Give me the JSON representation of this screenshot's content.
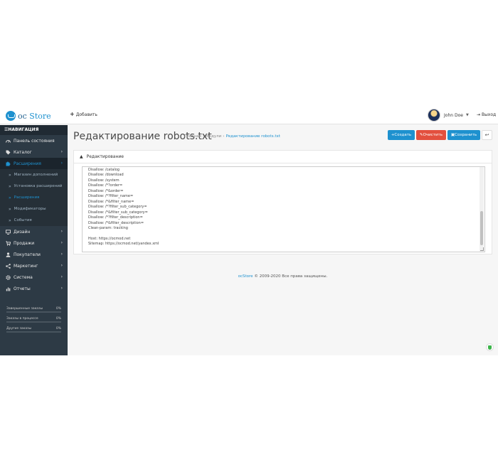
{
  "header": {
    "logo_prefix": "oc",
    "logo_name": "Store",
    "add_label": "Добавить",
    "user_name": "John Doe",
    "logout_label": "Выход"
  },
  "sidebar": {
    "nav_title": "НАВИГАЦИЯ",
    "items": [
      {
        "label": "Панель состояния",
        "icon": "dashboard-icon"
      },
      {
        "label": "Каталог",
        "icon": "tag-icon"
      },
      {
        "label": "Расширения",
        "icon": "puzzle-icon"
      },
      {
        "label": "Дизайн",
        "icon": "monitor-icon"
      },
      {
        "label": "Продажи",
        "icon": "cart-icon"
      },
      {
        "label": "Покупатели",
        "icon": "user-icon"
      },
      {
        "label": "Маркетинг",
        "icon": "share-icon"
      },
      {
        "label": "Система",
        "icon": "gear-icon"
      },
      {
        "label": "Отчеты",
        "icon": "bar-chart-icon"
      }
    ],
    "sub_items": [
      {
        "label": "Магазин дополнений"
      },
      {
        "label": "Установка расширений"
      },
      {
        "label": "Расширения"
      },
      {
        "label": "Модификаторы"
      },
      {
        "label": "События"
      }
    ],
    "stats": [
      {
        "label": "Завершенные заказы",
        "value": "0%",
        "fill": 0
      },
      {
        "label": "Заказы в процессе",
        "value": "0%",
        "fill": 0
      },
      {
        "label": "Другие заказы",
        "value": "0%",
        "fill": 0
      }
    ]
  },
  "page": {
    "title": "Редактирование robots.txt",
    "breadcrumb": [
      "Главная",
      "Модули",
      "Редактирование robots.txt"
    ],
    "buttons": {
      "create": "Создать",
      "clear": "Очистить",
      "save": "Сохранить"
    },
    "panel_title": "Редактирование",
    "editor_text": "Disallow: /catalog\nDisallow: /download\nDisallow: /system\nDisallow: /*?order=\nDisallow: /*&order=\nDisallow: /*?filter_name=\nDisallow: /*&filter_name=\nDisallow: /*?filter_sub_category=\nDisallow: /*&filter_sub_category=\nDisallow: /*?filter_description=\nDisallow: /*&filter_description=\nClean-param: tracking\n\nHost: https://ocmod.net\nSitemap: https://ocmod.net/yandex.xml"
  },
  "footer": {
    "brand": "ocStore",
    "text": "© 2009-2020 Все права защищены."
  },
  "colors": {
    "accent": "#1e91cf",
    "danger": "#e3503e",
    "sidebar": "#2d3a45"
  }
}
